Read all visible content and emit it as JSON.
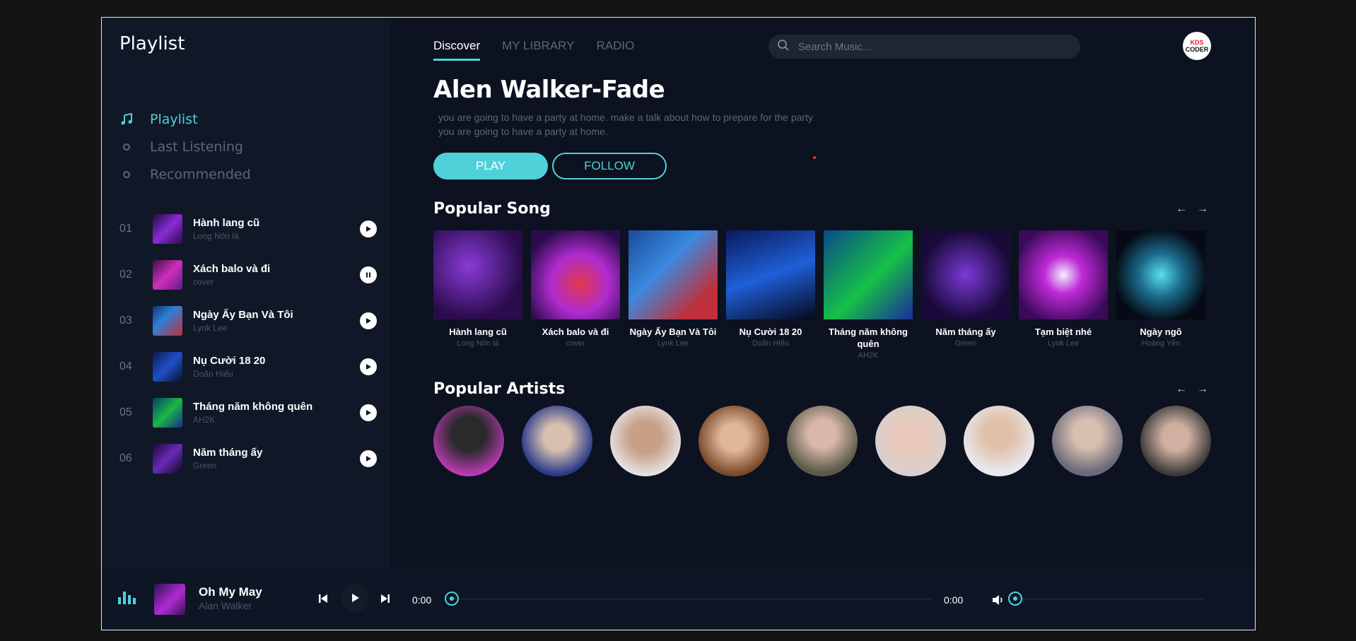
{
  "sidebar": {
    "title": "Playlist",
    "nav": [
      {
        "label": "Playlist",
        "icon": "music-note-icon",
        "active": true
      },
      {
        "label": "Last Listening",
        "icon": "circle-icon",
        "active": false
      },
      {
        "label": "Recommended",
        "icon": "circle-icon",
        "active": false
      }
    ],
    "tracks": [
      {
        "num": "01",
        "title": "Hành lang cũ",
        "artist": "Long Nón lá",
        "state": "play"
      },
      {
        "num": "02",
        "title": "Xách balo và đi",
        "artist": "cover",
        "state": "pause"
      },
      {
        "num": "03",
        "title": "Ngày Ấy Bạn Và Tôi",
        "artist": "Lynk Lee",
        "state": "play"
      },
      {
        "num": "04",
        "title": "Nụ Cười 18 20",
        "artist": "Doãn Hiếu",
        "state": "play"
      },
      {
        "num": "05",
        "title": "Tháng năm không quên",
        "artist": "AH2K",
        "state": "play"
      },
      {
        "num": "06",
        "title": "Năm tháng ấy",
        "artist": "Green",
        "state": "play"
      }
    ]
  },
  "header": {
    "tabs": [
      "Discover",
      "MY LIBRARY",
      "RADIO"
    ],
    "active_tab": "Discover",
    "search_placeholder": "Search Music...",
    "logo_line1": "KDS",
    "logo_line2": "CODER"
  },
  "hero": {
    "title": "Alen Walker-Fade",
    "desc_line1": "you are going to have a party at home. make a talk about how to prepare for the party",
    "desc_line2": "you are going to have a party at home.",
    "play_label": "PLAY",
    "follow_label": "FOLLOW"
  },
  "popular_songs": {
    "title": "Popular Song",
    "items": [
      {
        "title": "Hành lang cũ",
        "artist": "Long Nón lá"
      },
      {
        "title": "Xách balo và đi",
        "artist": "cover"
      },
      {
        "title": "Ngày Ấy Bạn Và Tôi",
        "artist": "Lynk Lee"
      },
      {
        "title": "Nụ Cười 18 20",
        "artist": "Doãn Hiếu"
      },
      {
        "title": "Tháng năm không quên",
        "artist": "AH2K"
      },
      {
        "title": "Năm tháng ấy",
        "artist": "Green"
      },
      {
        "title": "Tạm biệt nhé",
        "artist": "Lynk Lee"
      },
      {
        "title": "Ngày ngô",
        "artist": "Hoàng Yến"
      }
    ]
  },
  "popular_artists": {
    "title": "Popular Artists",
    "count": 9
  },
  "player": {
    "title": "Oh My May",
    "artist": "Alan Walker",
    "current_time": "0:00",
    "duration": "0:00",
    "progress": 0,
    "volume": 0
  },
  "colors": {
    "accent": "#4fd1d9",
    "background": "#0c1220",
    "sidebar": "#101828"
  }
}
